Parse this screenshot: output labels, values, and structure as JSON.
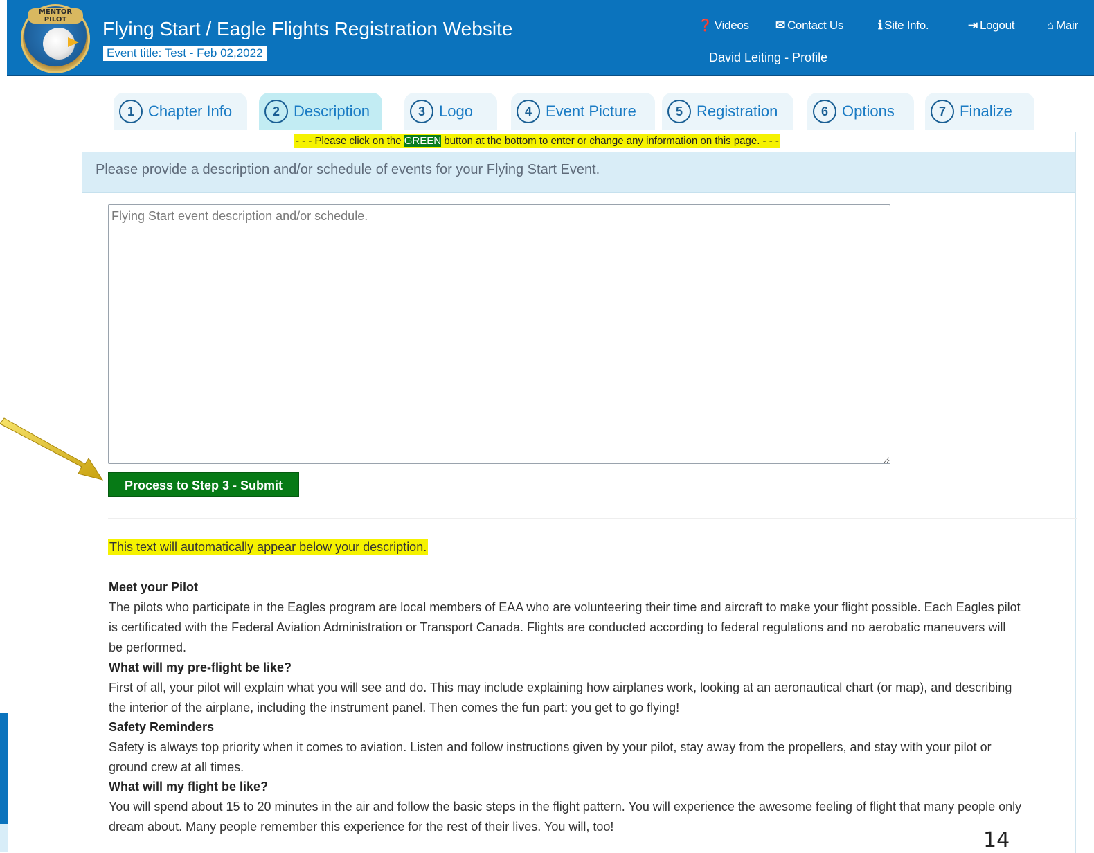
{
  "header": {
    "logo_text": "MENTOR PILOT · EAGLE FLIGHTS",
    "site_title": "Flying Start / Eagle Flights Registration Website",
    "event_title_label": "Event title: Test - Feb 02,2022",
    "nav": [
      {
        "icon": "question-circle-icon",
        "glyph": "❓",
        "label": "Videos"
      },
      {
        "icon": "envelope-icon",
        "glyph": "✉",
        "label": "Contact Us"
      },
      {
        "icon": "info-circle-icon",
        "glyph": "ℹ",
        "label": "Site Info."
      },
      {
        "icon": "logout-icon",
        "glyph": "⇥",
        "label": "Logout"
      },
      {
        "icon": "home-icon",
        "glyph": "⌂",
        "label": "Mair"
      }
    ],
    "profile_label": "David Leiting - Profile"
  },
  "tabs": [
    {
      "num": "1",
      "label": "Chapter Info",
      "active": false
    },
    {
      "num": "2",
      "label": "Description",
      "active": true
    },
    {
      "num": "3",
      "label": "Logo",
      "active": false
    },
    {
      "num": "4",
      "label": "Event Picture",
      "active": false
    },
    {
      "num": "5",
      "label": "Registration",
      "active": false
    },
    {
      "num": "6",
      "label": "Options",
      "active": false
    },
    {
      "num": "7",
      "label": "Finalize",
      "active": false
    }
  ],
  "notice": {
    "prefix": "- - - Please click on the ",
    "highlight": "GREEN",
    "suffix": " button at the bottom to enter or change any information on this page. - - -"
  },
  "prompt": "Please provide a description and/or schedule of events for your Flying Start Event.",
  "description": {
    "placeholder": "Flying Start event description and/or schedule.",
    "value": ""
  },
  "submit_label": "Process to Step 3 - Submit",
  "auto_note": "This text will automatically appear below your description.",
  "sections": [
    {
      "heading": "Meet your Pilot",
      "body": "The pilots who participate in the Eagles program are local members of EAA who are volunteering their time and aircraft to make your flight possible. Each Eagles pilot is certificated with the Federal Aviation Administration or Transport Canada. Flights are conducted according to federal regulations and no aerobatic maneuvers will be performed."
    },
    {
      "heading": "What will my pre-flight be like?",
      "body": "First of all, your pilot will explain what you will see and do. This may include explaining how airplanes work, looking at an aeronautical chart (or map), and describing the interior of the airplane, including the instrument panel. Then comes the fun part: you get to go flying!"
    },
    {
      "heading": "Safety Reminders",
      "body": "Safety is always top priority when it comes to aviation. Listen and follow instructions given by your pilot, stay away from the propellers, and stay with your pilot or ground crew at all times."
    },
    {
      "heading": "What will my flight be like?",
      "body": "You will spend about 15 to 20 minutes in the air and follow the basic steps in the flight pattern. You will experience the awesome feeling of flight that many people only dream about. Many people remember this experience for the rest of their lives. You will, too!"
    }
  ],
  "page_number": "14",
  "colors": {
    "header_blue": "#0b73bd",
    "active_tab": "#c2ecf3",
    "submit_green": "#077a16",
    "highlight_yellow": "#f5f200",
    "arrow_gold": "#e5c420"
  }
}
